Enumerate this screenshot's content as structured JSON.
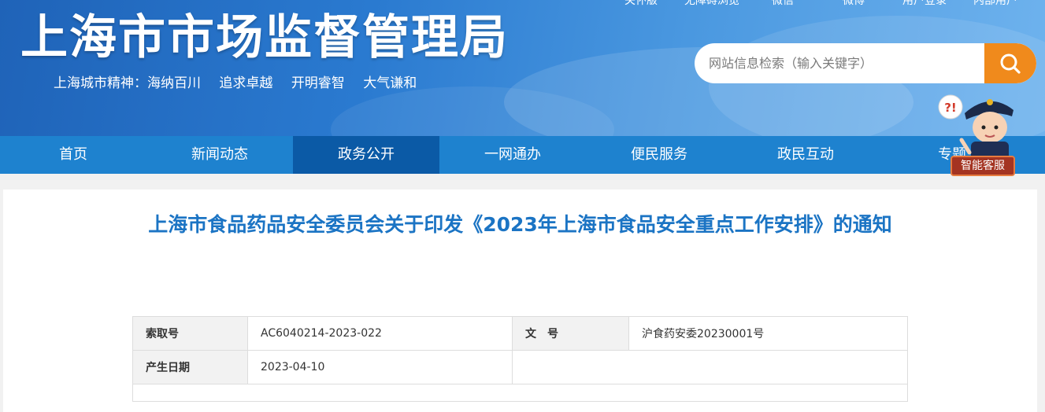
{
  "header": {
    "title": "上海市市场监督管理局",
    "slogan": [
      "上海城市精神：海纳百川",
      "追求卓越",
      "开明睿智",
      "大气谦和"
    ],
    "top_links": [
      "关怀版",
      "无障碍浏览",
      "微信",
      "微博",
      "用户登录",
      "内部用户"
    ],
    "search": {
      "placeholder": "网站信息检索（输入关键字）",
      "icon": "search-icon"
    }
  },
  "nav": {
    "items": [
      "首页",
      "新闻动态",
      "政务公开",
      "一网通办",
      "便民服务",
      "政民互动",
      "专题"
    ],
    "active_index": 2
  },
  "assistant": {
    "label": "智能客服",
    "badge": "?!"
  },
  "article": {
    "title": "上海市食品药品安全委员会关于印发《2023年上海市食品安全重点工作安排》的通知",
    "meta": {
      "index_label": "索取号",
      "index_value": "AC6040214-2023-022",
      "docno_label": "文　号",
      "docno_value": "沪食药安委20230001号",
      "date_label": "产生日期",
      "date_value": "2023-04-10"
    }
  },
  "colors": {
    "nav_bg": "#1e82cf",
    "nav_active": "#0b5aa6",
    "search_button": "#f08a1c",
    "title_blue": "#1b74c4"
  }
}
